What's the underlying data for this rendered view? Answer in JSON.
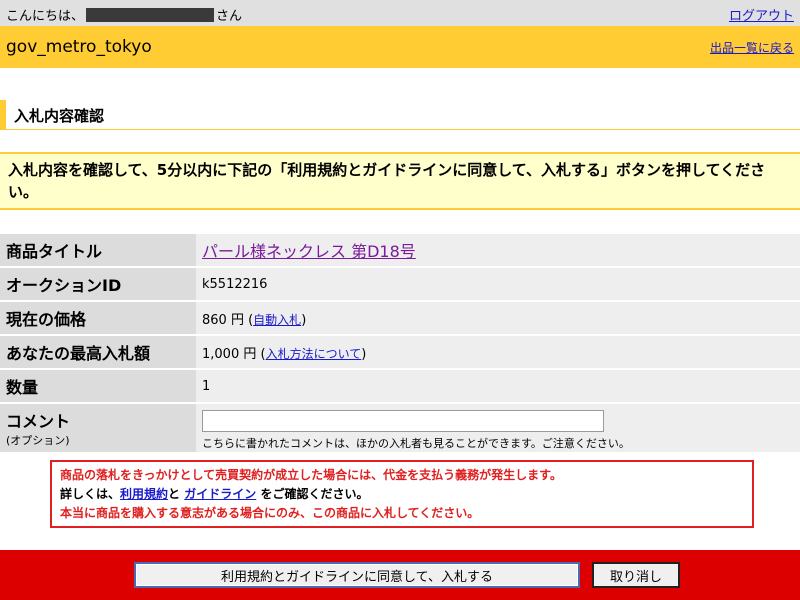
{
  "top_bar": {
    "greeting_prefix": "こんにちは、",
    "greeting_suffix": "さん",
    "logout_label": "ログアウト"
  },
  "header": {
    "site_id": "gov_metro_tokyo",
    "back_link": "出品一覧に戻る"
  },
  "section_title": "入札内容確認",
  "notice": "入札内容を確認して、5分以内に下記の「利用規約とガイドラインに同意して、入札する」ボタンを押してください。",
  "details": {
    "title_label": "商品タイトル",
    "title_value": "パール様ネックレス 第D18号",
    "auction_id_label": "オークションID",
    "auction_id_value": "k5512216",
    "price_label": "現在の価格",
    "price_value": "860 円",
    "price_link": "自動入札",
    "max_bid_label": "あなたの最高入札額",
    "max_bid_value": "1,000 円",
    "max_bid_link": "入札方法について",
    "quantity_label": "数量",
    "quantity_value": "1",
    "comment_label": "コメント",
    "comment_sub": "(オプション)",
    "comment_value": "",
    "comment_note": "こちらに書かれたコメントは、ほかの入札者も見ることができます。ご注意ください。"
  },
  "warning": {
    "line1": "商品の落札をきっかけとして売買契約が成立した場合には、代金を支払う義務が発生します。",
    "line2_prefix": "詳しくは、",
    "terms_link": "利用規約",
    "and_text": "と",
    "guideline_link": "ガイドライン",
    "line2_suffix": "をご確認ください。",
    "line3": "本当に商品を購入する意志がある場合にのみ、この商品に入札してください。"
  },
  "footer": {
    "agree_button": "利用規約とガイドラインに同意して、入札する",
    "cancel_button": "取り消し"
  },
  "colors": {
    "header_bg": "#ffcc33",
    "notice_bg": "#ffffcc",
    "footer_bg": "#dd0000",
    "warning_text": "#e02020",
    "link": "#1a1acc"
  }
}
